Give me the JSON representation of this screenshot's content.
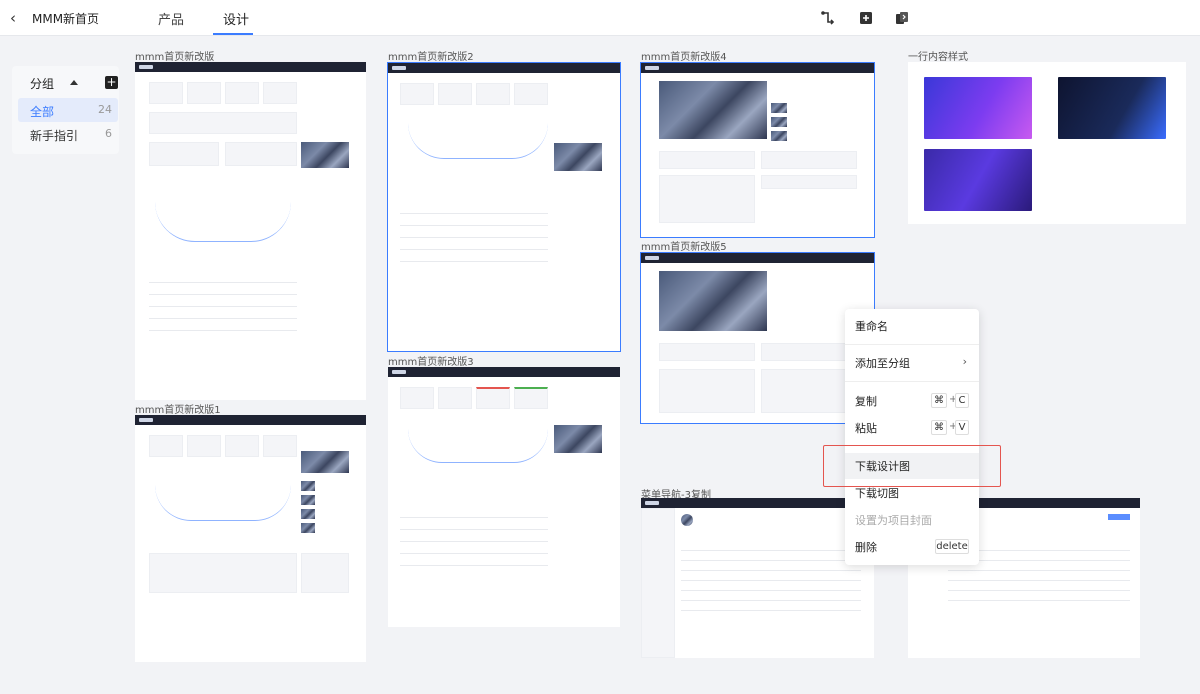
{
  "topbar": {
    "project_title": "MMM新首页",
    "tabs": [
      "产品",
      "设计"
    ],
    "active_tab": "设计"
  },
  "groups": {
    "title": "分组",
    "items": [
      {
        "label": "全部",
        "count": "24",
        "active": true
      },
      {
        "label": "新手指引",
        "count": "6",
        "active": false
      }
    ]
  },
  "artboards": [
    {
      "title": "mmm首页新改版"
    },
    {
      "title": "mmm首页新改版2"
    },
    {
      "title": "mmm首页新改版4"
    },
    {
      "title": "一行内容样式"
    },
    {
      "title": "mmm首页新改版5"
    },
    {
      "title": "mmm首页新改版3"
    },
    {
      "title": "mmm首页新改版1"
    },
    {
      "title": "菜单导航-3复制"
    }
  ],
  "context_menu": {
    "rename": "重命名",
    "add_to_group": "添加至分组",
    "copy": "复制",
    "copy_key": "⌘",
    "copy_key2": "C",
    "paste": "粘贴",
    "paste_key": "⌘",
    "paste_key2": "V",
    "download_design": "下载设计图",
    "download_slices": "下载切图",
    "set_cover": "设置为项目封面",
    "delete": "删除",
    "delete_key": "delete",
    "plus": "+"
  },
  "colors": {
    "accent": "#3b7cff",
    "highlight_border": "#e4554f",
    "artboard_header": "#1f2333"
  }
}
